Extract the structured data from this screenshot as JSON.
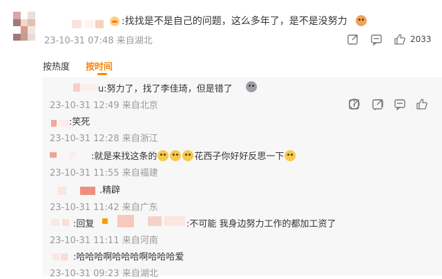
{
  "main_comment": {
    "text": ":找找是不是自己的问题，这么多年了，是不是没努力",
    "meta": "23-10-31 07:48 来自湖北",
    "like_count": "2033",
    "icons": [
      "share-icon",
      "comment-icon",
      "like-icon"
    ]
  },
  "sort": {
    "hot": "按热度",
    "time": "按时间"
  },
  "replies": [
    {
      "text": "u:努力了，找了李佳琦，但是错了",
      "meta": "23-10-31 12:49 来自北京"
    },
    {
      "text": ":笑死",
      "meta": "23-10-31 12:28 来自浙江"
    },
    {
      "text_a": ":就是来找这条的",
      "text_b": "花西子你好好反思一下",
      "meta": "23-10-31 11:55 来自福建"
    },
    {
      "text": ".精辟",
      "meta": "23-10-31 11:42 来自广东"
    },
    {
      "text_a": ":回复",
      "text_b": ":不可能 我身边努力工作的都加工资了",
      "meta": "23-10-31 11:11 来自河南"
    },
    {
      "text": ":哈哈哈啊哈哈哈啊哈哈哈爱",
      "meta": "23-10-31 09:23 来自湖北"
    }
  ]
}
